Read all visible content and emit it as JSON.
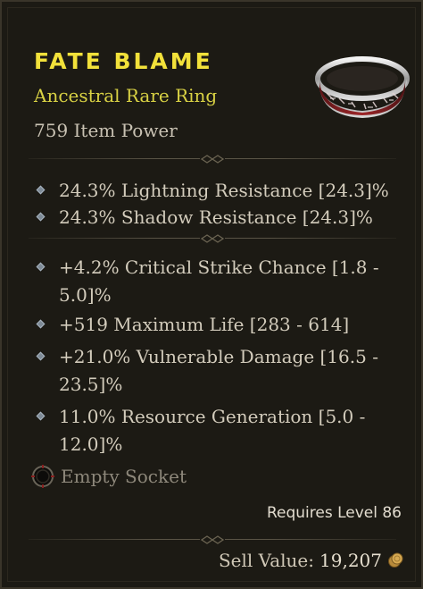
{
  "item": {
    "name": "Fate Blame",
    "type": "Ancestral Rare Ring",
    "power": "759 Item Power",
    "icon": "ring-icon"
  },
  "implicits": [
    "24.3% Lightning Resistance [24.3]%",
    "24.3% Shadow Resistance [24.3]%"
  ],
  "affixes": [
    {
      "line1": "+4.2% Critical Strike Chance [1.8 -",
      "line2": "5.0]%"
    },
    {
      "line1": "+519 Maximum Life [283 - 614]",
      "line2": ""
    },
    {
      "line1": "+21.0% Vulnerable Damage [16.5 -",
      "line2": "23.5]%"
    },
    {
      "line1": "11.0% Resource Generation [5.0 -",
      "line2": "12.0]%"
    }
  ],
  "socket": {
    "label": "Empty Socket",
    "icon": "empty-socket-icon"
  },
  "requirement": "Requires Level 86",
  "sell": {
    "label": "Sell Value:",
    "value": "19,207",
    "icon": "gold-coin-icon"
  },
  "colors": {
    "name": "#f2e13a",
    "type": "#d9d244",
    "text": "#d3ccbc",
    "background": "#1c1a14"
  }
}
